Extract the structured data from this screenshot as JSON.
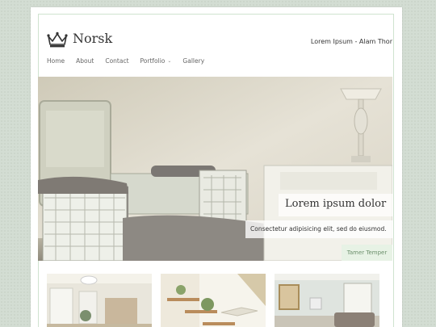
{
  "header": {
    "site_title": "Norsk",
    "tagline": "Lorem Ipsum - Alam Thor",
    "logo_icon": "crown-icon"
  },
  "nav": {
    "items": [
      {
        "label": "Home"
      },
      {
        "label": "About"
      },
      {
        "label": "Contact"
      },
      {
        "label": "Portfolio",
        "has_dropdown": true
      },
      {
        "label": "Gallery"
      }
    ]
  },
  "hero": {
    "title": "Lorem ipsum dolor",
    "text": "Consectetur adipisicing elit, sed do eiusmod.",
    "button_label": "Tamer Temper"
  },
  "colors": {
    "accent": "#6b8f6b",
    "frame_border": "#cfe3cf",
    "background": "#d3ddd3"
  }
}
